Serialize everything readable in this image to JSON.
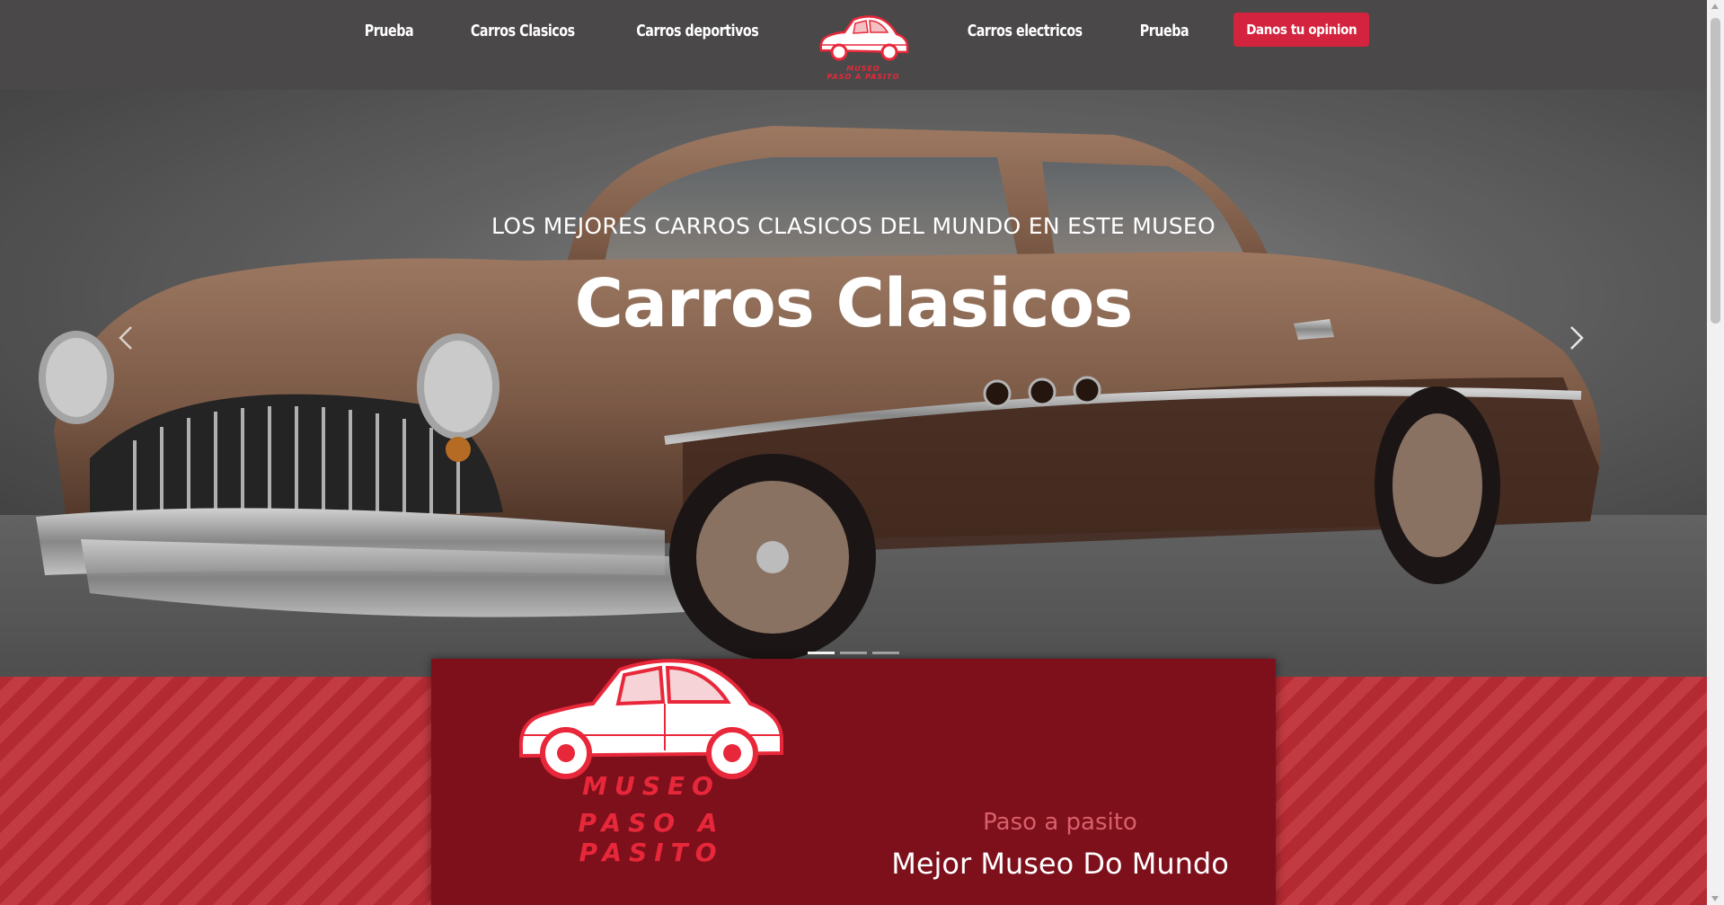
{
  "nav": {
    "links": [
      "Prueba",
      "Carros Clasicos",
      "Carros deportivos",
      "Carros electricos",
      "Prueba"
    ],
    "logo_line1": "MUSEO",
    "logo_line2": "PASO A PASITO",
    "cta_label": "Danos tu opinion"
  },
  "hero": {
    "subtitle": "LOS MEJORES CARROS CLASICOS DEL MUNDO EN ESTE MUSEO",
    "title": "Carros Clasicos",
    "active_slide": 1,
    "slide_count": 3
  },
  "museum": {
    "logo_line1": "MUSEO",
    "logo_line2": "PASO A PASITO",
    "tagline": "Paso a pasito",
    "headline": "Mejor Museo Do Mundo"
  },
  "colors": {
    "navbar": "#4a4848",
    "accent": "#d4233e",
    "card": "#7e101c",
    "stripe_dark": "#b42a33",
    "stripe_light": "#c23a42",
    "logo_red": "#e8283a"
  },
  "icons": {
    "prev": "chevron-left-icon",
    "next": "chevron-right-icon"
  }
}
